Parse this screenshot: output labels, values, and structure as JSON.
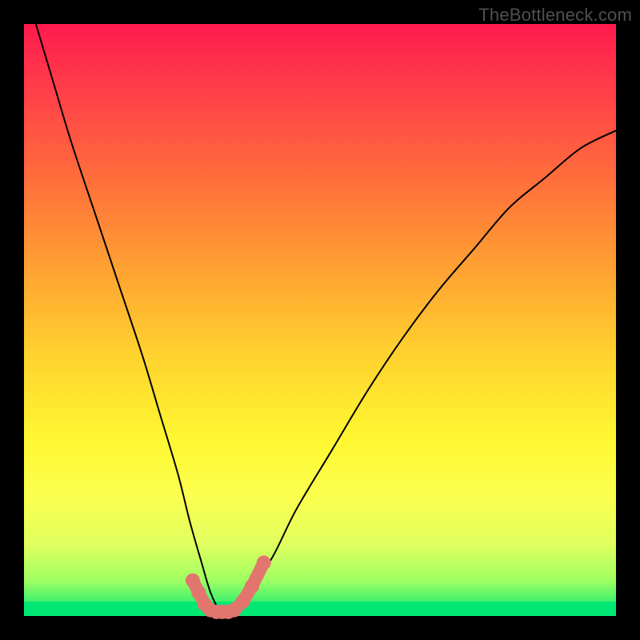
{
  "watermark": "TheBottleneck.com",
  "chart_data": {
    "type": "line",
    "title": "",
    "xlabel": "",
    "ylabel": "",
    "xlim": [
      0,
      100
    ],
    "ylim": [
      0,
      100
    ],
    "grid": false,
    "legend": false,
    "background_gradient": {
      "top": "#ff1a4d",
      "bottom": "#00e873",
      "meaning": "red=high bottleneck, green=no bottleneck"
    },
    "optimal_band_y": [
      0,
      2.5
    ],
    "series": [
      {
        "name": "bottleneck-curve",
        "color": "#000000",
        "x": [
          2,
          5,
          8,
          12,
          16,
          20,
          23,
          26,
          28,
          30,
          31.5,
          33,
          34.5,
          36,
          38,
          42,
          46,
          52,
          58,
          64,
          70,
          76,
          82,
          88,
          94,
          100
        ],
        "y": [
          100,
          90,
          80,
          68,
          56,
          44,
          34,
          24,
          16,
          9,
          4,
          1,
          0,
          1,
          4,
          10,
          18,
          28,
          38,
          47,
          55,
          62,
          69,
          74,
          79,
          82
        ]
      },
      {
        "name": "optimal-range-marker",
        "type": "scatter",
        "color": "#e2766e",
        "x": [
          28.5,
          29.5,
          30.5,
          31.5,
          32.5,
          33.5,
          34.5,
          35.5,
          37,
          38.5,
          40.5
        ],
        "y": [
          6,
          4,
          2,
          1,
          0.7,
          0.7,
          0.7,
          1,
          2.5,
          5,
          9
        ]
      }
    ]
  }
}
